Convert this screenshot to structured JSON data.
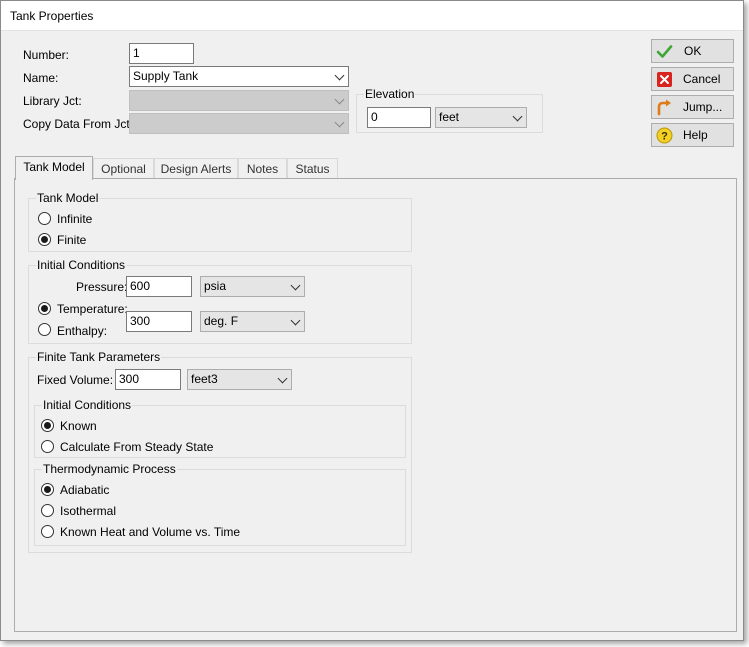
{
  "window": {
    "title": "Tank Properties"
  },
  "fields": {
    "number_label": "Number:",
    "number_value": "1",
    "name_label": "Name:",
    "name_value": "Supply Tank",
    "library_label": "Library Jct:",
    "library_value": "",
    "copy_label": "Copy Data From Jct...",
    "copy_value": ""
  },
  "elevation": {
    "title": "Elevation",
    "value": "0",
    "unit": "feet"
  },
  "buttons": {
    "ok": "OK",
    "cancel": "Cancel",
    "jump": "Jump...",
    "help": "Help"
  },
  "tabs": [
    {
      "label": "Tank Model",
      "active": true
    },
    {
      "label": "Optional",
      "active": false
    },
    {
      "label": "Design Alerts",
      "active": false
    },
    {
      "label": "Notes",
      "active": false
    },
    {
      "label": "Status",
      "active": false
    }
  ],
  "tank_model": {
    "title": "Tank Model",
    "options": [
      "Infinite",
      "Finite"
    ],
    "selected": "Finite"
  },
  "initial_conditions": {
    "title": "Initial Conditions",
    "pressure_label": "Pressure:",
    "pressure_value": "600",
    "pressure_unit": "psia",
    "temperature_label": "Temperature:",
    "enthalpy_label": "Enthalpy:",
    "temperature_value": "300",
    "temperature_unit": "deg. F",
    "selected": "Temperature"
  },
  "finite_tank": {
    "title": "Finite Tank Parameters",
    "fixed_volume_label": "Fixed Volume:",
    "fixed_volume_value": "300",
    "fixed_volume_unit": "feet3",
    "initial_conditions": {
      "title": "Initial Conditions",
      "options": [
        "Known",
        "Calculate From Steady State"
      ],
      "selected": "Known"
    },
    "thermo": {
      "title": "Thermodynamic Process",
      "options": [
        "Adiabatic",
        "Isothermal",
        "Known Heat and Volume vs. Time"
      ],
      "selected": "Adiabatic"
    }
  }
}
